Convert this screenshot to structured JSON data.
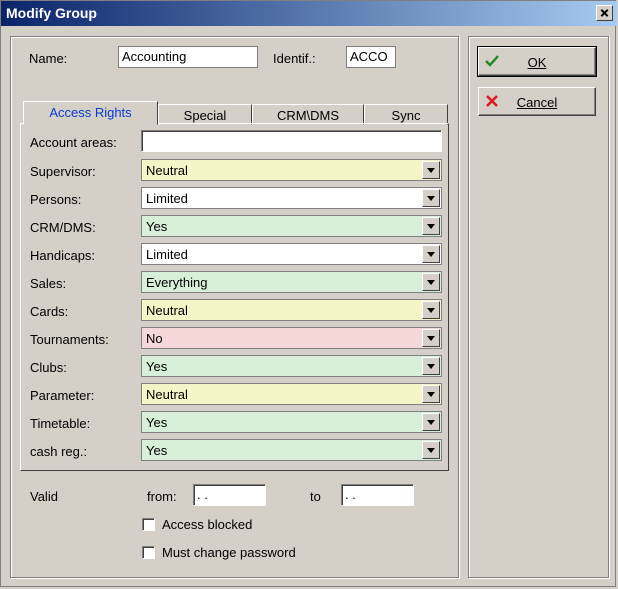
{
  "window": {
    "title": "Modify Group"
  },
  "header": {
    "name_label": "Name:",
    "name_value": "Accounting",
    "ident_label": "Identif.:",
    "ident_value": "ACCO"
  },
  "buttons": {
    "ok_label": "OK",
    "cancel_label": "Cancel"
  },
  "tabs": [
    {
      "label": "Access Rights",
      "active": true
    },
    {
      "label": "Special"
    },
    {
      "label": "CRM\\DMS"
    },
    {
      "label": "Sync"
    }
  ],
  "access_rights": {
    "account_areas_label": "Account areas:",
    "account_areas_value": "",
    "rows": [
      {
        "label": "Supervisor:",
        "value": "Neutral",
        "color": "#f5f5c8"
      },
      {
        "label": "Persons:",
        "value": "Limited",
        "color": "#ffffff"
      },
      {
        "label": "CRM/DMS:",
        "value": "Yes",
        "color": "#d8efd8"
      },
      {
        "label": "Handicaps:",
        "value": "Limited",
        "color": "#ffffff"
      },
      {
        "label": "Sales:",
        "value": "Everything",
        "color": "#d8efd8"
      },
      {
        "label": "Cards:",
        "value": "Neutral",
        "color": "#f5f5c8"
      },
      {
        "label": "Tournaments:",
        "value": "No",
        "color": "#f5d8d8"
      },
      {
        "label": "Clubs:",
        "value": "Yes",
        "color": "#d8efd8"
      },
      {
        "label": "Parameter:",
        "value": "Neutral",
        "color": "#f5f5c8"
      },
      {
        "label": "Timetable:",
        "value": "Yes",
        "color": "#d8efd8"
      },
      {
        "label": "cash reg.:",
        "value": "Yes",
        "color": "#d8efd8"
      }
    ]
  },
  "valid": {
    "label": "Valid",
    "from_label": "from:",
    "from_value": " . .",
    "to_label": "to",
    "to_value": " . ."
  },
  "options": {
    "access_blocked_label": "Access blocked",
    "must_change_password_label": "Must change password"
  }
}
